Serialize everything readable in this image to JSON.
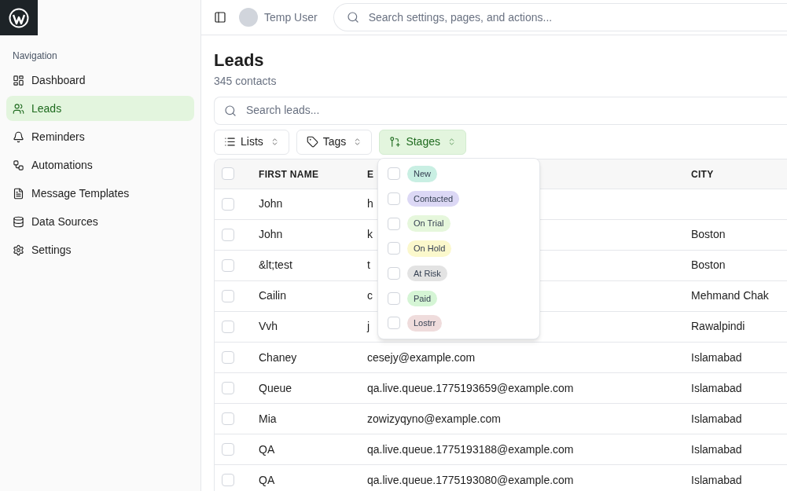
{
  "sidebar": {
    "heading": "Navigation",
    "items": [
      {
        "label": "Dashboard",
        "selected": false
      },
      {
        "label": "Leads",
        "selected": true
      },
      {
        "label": "Reminders",
        "selected": false
      },
      {
        "label": "Automations",
        "selected": false
      },
      {
        "label": "Message Templates",
        "selected": false
      },
      {
        "label": "Data Sources",
        "selected": false
      },
      {
        "label": "Settings",
        "selected": false
      }
    ]
  },
  "topbar": {
    "user": "Temp User",
    "search_placeholder": "Search settings, pages, and actions..."
  },
  "page": {
    "title": "Leads",
    "subtitle": "345 contacts",
    "search_placeholder": "Search leads..."
  },
  "filters": [
    {
      "label": "Lists",
      "selected": false
    },
    {
      "label": "Tags",
      "selected": false
    },
    {
      "label": "Stages",
      "selected": true
    }
  ],
  "stages_menu": [
    {
      "label": "New",
      "checked": false,
      "color": "#c9efe3"
    },
    {
      "label": "Contacted",
      "checked": false,
      "color": "#dcd8f5"
    },
    {
      "label": "On Trial",
      "checked": false,
      "color": "#e6f7dc"
    },
    {
      "label": "On Hold",
      "checked": false,
      "color": "#fbf8cc"
    },
    {
      "label": "At Risk",
      "checked": false,
      "color": "#e3e3e3"
    },
    {
      "label": "Paid",
      "checked": false,
      "color": "#d5f5d5"
    },
    {
      "label": "Lostrr",
      "checked": false,
      "color": "#efdcdc"
    }
  ],
  "table": {
    "all_checked": false,
    "columns": [
      "FIRST NAME",
      "E",
      "CITY"
    ],
    "rows": [
      {
        "checked": false,
        "cells": [
          "John",
          "h",
          ""
        ]
      },
      {
        "checked": false,
        "cells": [
          "John",
          "k",
          "Boston"
        ]
      },
      {
        "checked": false,
        "cells": [
          "&lt;test",
          "t",
          "Boston"
        ]
      },
      {
        "checked": false,
        "cells": [
          "Cailin",
          "c",
          "Mehmand Chak"
        ]
      },
      {
        "checked": false,
        "cells": [
          "Vvh",
          "j",
          "Rawalpindi"
        ]
      },
      {
        "checked": false,
        "cells": [
          "Chaney",
          "cesejy@example.com",
          "Islamabad"
        ]
      },
      {
        "checked": false,
        "cells": [
          "Queue",
          "qa.live.queue.1775193659@example.com",
          "Islamabad"
        ]
      },
      {
        "checked": false,
        "cells": [
          "Mia",
          "zowizyqyno@example.com",
          "Islamabad"
        ]
      },
      {
        "checked": false,
        "cells": [
          "QA",
          "qa.live.queue.1775193188@example.com",
          "Islamabad"
        ]
      },
      {
        "checked": false,
        "cells": [
          "QA",
          "qa.live.queue.1775193080@example.com",
          "Islamabad"
        ]
      }
    ]
  }
}
